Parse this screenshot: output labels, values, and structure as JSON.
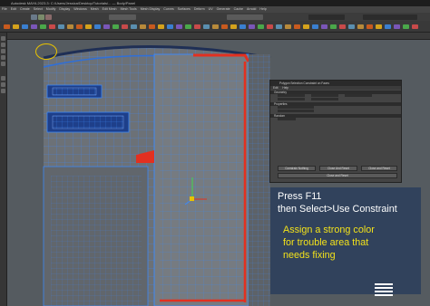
{
  "window": {
    "title": "Autodesk MAYA 2023.3: C:/Users/Jessica/Desktop/Tutorials/... — Body/Panel",
    "app_icon": "maya-logo-icon"
  },
  "menubar": {
    "items": [
      "File",
      "Edit",
      "Create",
      "Select",
      "Modify",
      "Display",
      "Windows",
      "Mesh",
      "Edit Mesh",
      "Mesh Tools",
      "Mesh Display",
      "Curves",
      "Surfaces",
      "Deform",
      "UV",
      "Generate",
      "Cache",
      "Arnold",
      "Help"
    ]
  },
  "overlay": {
    "instruction_line1": "Press  F11",
    "instruction_line2": "then Select>Use Constraint",
    "tip_line1": "Assign a strong color",
    "tip_line2": "for trouble area that",
    "tip_line3": "needs fixing",
    "instruction_color": "#ffffff",
    "tip_color": "#f3e21a"
  },
  "dialog": {
    "title": "Polygon Selection Constraint on Faces",
    "menu_items": [
      "Edit",
      "Help"
    ],
    "sections": [
      "Geometry",
      "Properties",
      "Random",
      "Random",
      "Resets"
    ],
    "section_1_label": "Geometry",
    "section_2_label": "Properties",
    "section_3_label": "Random",
    "buttons": [
      "Constrain Nothing",
      "Close And Reset",
      "Close",
      "Close and Reset"
    ],
    "button_1": "Constrain Nothing",
    "button_2": "Close And Reset",
    "button_3": "Close and Reset"
  },
  "colors": {
    "highlight_red": "#e23020",
    "wire_blue": "#3e88f5",
    "selection_ring": "#e8c200",
    "caption_bg": "#1a3a6e"
  }
}
